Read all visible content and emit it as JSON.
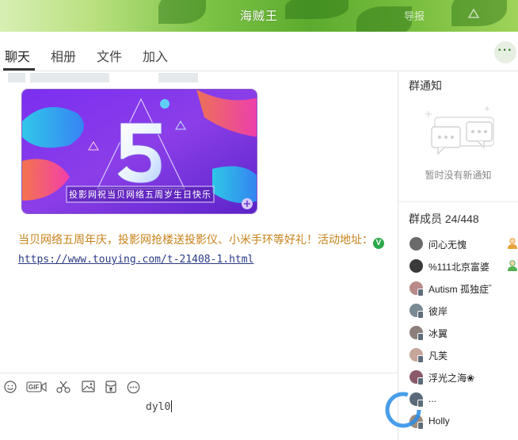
{
  "window": {
    "title": "海贼王",
    "faded_label": "导报"
  },
  "tabs": [
    {
      "label": "聊天",
      "active": true
    },
    {
      "label": "相册",
      "active": false
    },
    {
      "label": "文件",
      "active": false
    },
    {
      "label": "加入",
      "active": false
    }
  ],
  "more_button_icon": "more-dots-icon",
  "chat": {
    "promo_banner": {
      "number": "5",
      "caption": "投影网祝当贝网络五周岁生日快乐"
    },
    "message": {
      "text": "当贝网络五周年庆，投影网抢楼送投影仪、小米手环等好礼！活动地址：",
      "link_icon": "verified-v-icon",
      "link": "https://www.touying.com/t-21408-1.html"
    }
  },
  "compose": {
    "toolbar": [
      {
        "icon": "emoji-icon"
      },
      {
        "icon": "gif-icon",
        "label": "GIF"
      },
      {
        "icon": "scissors-icon"
      },
      {
        "icon": "image-icon"
      },
      {
        "icon": "red-packet-icon"
      },
      {
        "icon": "more-circle-icon"
      }
    ],
    "input_value": "dyl0"
  },
  "side": {
    "notice": {
      "title": "群通知",
      "empty_text": "暂时没有新通知"
    },
    "members": {
      "title": "群成员 24/448",
      "list": [
        {
          "name": "问心无愧",
          "avatar_color": "#6a6a6a",
          "role": "admin"
        },
        {
          "name": "%111北京富婆",
          "avatar_color": "#3a3a3a",
          "role": "admin"
        },
        {
          "name": "Autism 孤独症゛",
          "avatar_color": "#b98a8a",
          "role": ""
        },
        {
          "name": "彼岸",
          "avatar_color": "#7a8a94",
          "role": ""
        },
        {
          "name": "冰翼",
          "avatar_color": "#8c7f7a",
          "role": ""
        },
        {
          "name": "凡芙",
          "avatar_color": "#c7a79a",
          "role": ""
        },
        {
          "name": "浮光之海❀",
          "avatar_color": "#8a5a6a",
          "role": ""
        },
        {
          "name": "...",
          "avatar_color": "#5a6a7a",
          "role": ""
        },
        {
          "name": "Holly",
          "avatar_color": "#a08a7a",
          "role": ""
        }
      ]
    }
  }
}
